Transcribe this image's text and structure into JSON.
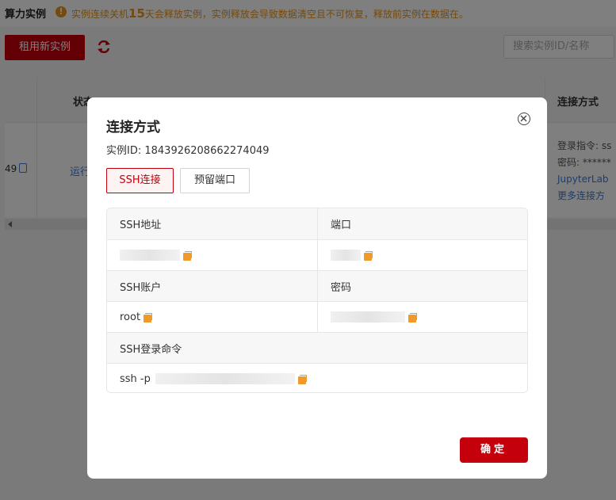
{
  "page": {
    "title": "算力实例",
    "warning_prefix": "实例连续关机",
    "warning_days": "15",
    "warning_suffix": "天会释放实例，实例释放会导致数据清空且不可恢复，释放前实例在数据在。",
    "rent_button": "租用新实例",
    "search_placeholder": "搜索实例ID/名称",
    "table": {
      "col_status": "状态",
      "col_connect": "连接方式",
      "row_id_tail": "49",
      "row_status": "运行",
      "row_login_cmd": "登录指令: ss",
      "row_password": "密码: ******",
      "row_jupyter": "JupyterLab",
      "row_more": "更多连接方"
    }
  },
  "dialog": {
    "title": "连接方式",
    "instance_id_label": "实例ID: ",
    "instance_id": "1843926208662274049",
    "tabs": [
      {
        "label": "SSH连接",
        "active": true
      },
      {
        "label": "预留端口",
        "active": false
      }
    ],
    "fields": {
      "ssh_address_label": "SSH地址",
      "port_label": "端口",
      "ssh_account_label": "SSH账户",
      "password_label": "密码",
      "ssh_account_value": "root",
      "ssh_command_label": "SSH登录命令",
      "ssh_command_value": "ssh -p"
    },
    "confirm_button": "确定"
  },
  "colors": {
    "brand_red": "#c4000c",
    "warning_orange": "#e8951c",
    "copy_icon": "#f09a2a",
    "link_blue": "#3b7ad8"
  }
}
